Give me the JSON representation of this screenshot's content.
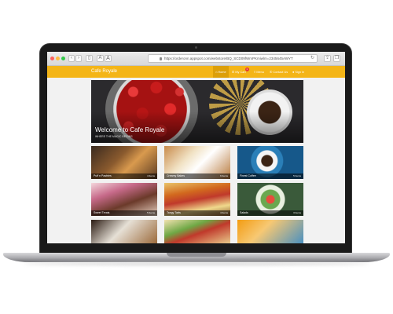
{
  "browser": {
    "url": "https://orderonn.appspot.com/webstore/BQ_SCD09fWmPKmiwlm=2345645AWYT",
    "back_icon": "chevron-left-icon",
    "forward_icon": "chevron-right-icon",
    "font_size_small": "A",
    "font_size_large": "A",
    "reload_glyph": "↻"
  },
  "navbar": {
    "brand": "Cafe Royale",
    "accent_color": "#f4b517",
    "items": [
      {
        "label": "Home",
        "icon": "home-icon",
        "glyph": "⌂"
      },
      {
        "label": "My Cart",
        "icon": "cart-icon",
        "glyph": "⊡",
        "badge": "1"
      },
      {
        "label": "Menu",
        "icon": "menu-icon",
        "glyph": "≡"
      },
      {
        "label": "Contact Us",
        "icon": "phone-icon",
        "glyph": "✆"
      },
      {
        "label": "Sign In",
        "icon": "user-icon",
        "glyph": "●"
      }
    ]
  },
  "hero": {
    "title": "Welcome to Cafe Royale",
    "subtitle": "WHERE THE MAGIC BEGINS"
  },
  "categories": [
    {
      "label": "Puff n Pastries",
      "items": "4 Items"
    },
    {
      "label": "Creamy Bakes",
      "items": "6 Items"
    },
    {
      "label": "Finest Coffee",
      "items": "5 Items"
    },
    {
      "label": "Sweet Treats",
      "items": "5 Items"
    },
    {
      "label": "Tangy Tarts",
      "items": "4 Items"
    },
    {
      "label": "Salads",
      "items": "3 Items"
    },
    {
      "label": "",
      "items": ""
    },
    {
      "label": "",
      "items": ""
    },
    {
      "label": "",
      "items": ""
    }
  ]
}
